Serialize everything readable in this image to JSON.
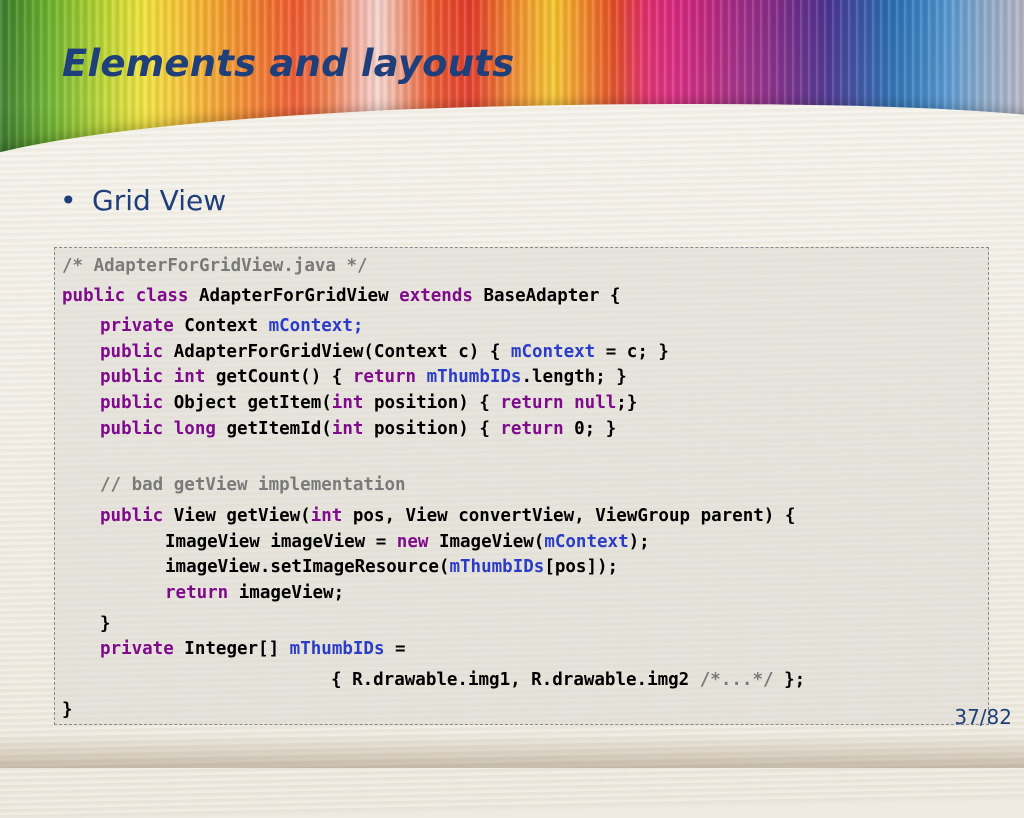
{
  "slide": {
    "title": "Elements and layouts",
    "bullet": "Grid View",
    "bullet_symbol": "•",
    "page_current": "37",
    "page_sep": "/",
    "page_total": "82"
  },
  "code": {
    "l1_comment": "/* AdapterForGridView.java */",
    "l2_kw1": "public class",
    "l2_t1": " AdapterForGridView ",
    "l2_kw2": "extends",
    "l2_t2": " BaseAdapter {",
    "l3_kw": "private",
    "l3_t": " Context ",
    "l3_fld": "mContext;",
    "l4_kw": "public",
    "l4_t1": " AdapterForGridView(Context c) { ",
    "l4_fld": "mContext",
    "l4_t2": " = c; }",
    "l5_kw1": "public int",
    "l5_t1": " getCount() { ",
    "l5_kw2": "return",
    "l5_sp": " ",
    "l5_fld": "mThumbIDs",
    "l5_t2": ".length; }",
    "l6_kw1": "public",
    "l6_t1": " Object getItem(",
    "l6_kw2": "int",
    "l6_t2": " position) { ",
    "l6_kw3": "return null",
    "l6_t3": ";}",
    "l7_kw1": "public long",
    "l7_t1": " getItemId(",
    "l7_kw2": "int",
    "l7_t2": " position) { ",
    "l7_kw3": "return",
    "l7_t3": " 0; }",
    "l8_comment": "// bad getView implementation",
    "l9_kw1": "public",
    "l9_t1": " View getView(",
    "l9_kw2": "int",
    "l9_t2": " pos, View convertView, ViewGroup parent) {",
    "l10_t1": "ImageView imageView = ",
    "l10_kw": "new",
    "l10_t2": " ImageView(",
    "l10_fld": "mContext",
    "l10_t3": ");",
    "l11_t1": "imageView.setImageResource(",
    "l11_fld": "mThumbIDs",
    "l11_t2": "[pos]);",
    "l12_kw": "return",
    "l12_t": " imageView;",
    "l13_t": "}",
    "l14_kw": "private",
    "l14_t1": " Integer[] ",
    "l14_fld": "mThumbIDs",
    "l14_t2": " =",
    "l15_t1": "{ R.drawable.img1, R.drawable.img2 ",
    "l15_cmt": "/*...*/",
    "l15_t2": " };",
    "l16_t": "}"
  }
}
